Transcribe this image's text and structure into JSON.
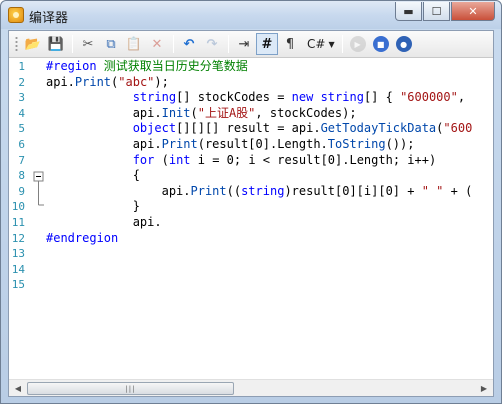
{
  "window": {
    "title": "编译器"
  },
  "toolbar": {
    "buttons": [
      {
        "name": "open-icon",
        "glyph": "📂"
      },
      {
        "name": "save-icon",
        "glyph": "💾"
      },
      {
        "name": "cut-icon",
        "glyph": "✂"
      },
      {
        "name": "copy-icon",
        "glyph": "⧉"
      },
      {
        "name": "paste-icon",
        "glyph": "📋"
      },
      {
        "name": "delete-icon",
        "glyph": "✕"
      },
      {
        "name": "undo-icon",
        "glyph": "↶"
      },
      {
        "name": "redo-icon",
        "glyph": "↷"
      },
      {
        "name": "wordwrap-icon",
        "glyph": "⇥"
      },
      {
        "name": "line-numbers-icon",
        "glyph": "#"
      },
      {
        "name": "paragraph-icon",
        "glyph": "¶"
      }
    ],
    "language": "C#",
    "run_buttons": [
      "run-icon",
      "stop-icon",
      "compile-icon"
    ]
  },
  "editor": {
    "line_numbers": [
      "1",
      "2",
      "3",
      "4",
      "5",
      "6",
      "7",
      "8",
      "9",
      "10",
      "11",
      "12",
      "13",
      "14",
      "15"
    ],
    "lines": [
      [
        {
          "t": "#region",
          "c": "rgkw"
        },
        {
          "t": " 测试获取当日历史分笔数据",
          "c": "rg"
        }
      ],
      [
        {
          "t": "api.",
          "c": "id"
        },
        {
          "t": "Print",
          "c": "mem"
        },
        {
          "t": "(",
          "c": "id"
        },
        {
          "t": "\"abc\"",
          "c": "str"
        },
        {
          "t": ");",
          "c": "id"
        }
      ],
      [
        {
          "t": "            ",
          "c": "id"
        },
        {
          "t": "string",
          "c": "kw"
        },
        {
          "t": "[] stockCodes = ",
          "c": "id"
        },
        {
          "t": "new",
          "c": "kw"
        },
        {
          "t": " ",
          "c": "id"
        },
        {
          "t": "string",
          "c": "kw"
        },
        {
          "t": "[] { ",
          "c": "id"
        },
        {
          "t": "\"600000\"",
          "c": "str"
        },
        {
          "t": ",",
          "c": "id"
        }
      ],
      [
        {
          "t": "            api.",
          "c": "id"
        },
        {
          "t": "Init",
          "c": "mem"
        },
        {
          "t": "(",
          "c": "id"
        },
        {
          "t": "\"上证A股\"",
          "c": "str"
        },
        {
          "t": ", stockCodes);",
          "c": "id"
        }
      ],
      [
        {
          "t": "            ",
          "c": "id"
        },
        {
          "t": "object",
          "c": "kw"
        },
        {
          "t": "[][][] result = api.",
          "c": "id"
        },
        {
          "t": "GetTodayTickData",
          "c": "mem"
        },
        {
          "t": "(",
          "c": "id"
        },
        {
          "t": "\"600",
          "c": "str"
        }
      ],
      [
        {
          "t": "            api.",
          "c": "id"
        },
        {
          "t": "Print",
          "c": "mem"
        },
        {
          "t": "(result[0].Length.",
          "c": "id"
        },
        {
          "t": "ToString",
          "c": "mem"
        },
        {
          "t": "());",
          "c": "id"
        }
      ],
      [
        {
          "t": "            ",
          "c": "id"
        },
        {
          "t": "for",
          "c": "kw"
        },
        {
          "t": " (",
          "c": "id"
        },
        {
          "t": "int",
          "c": "kw"
        },
        {
          "t": " i = 0; i < result[0].Length; i++)",
          "c": "id"
        }
      ],
      [
        {
          "t": "            {",
          "c": "id"
        }
      ],
      [
        {
          "t": "                api.",
          "c": "id"
        },
        {
          "t": "Print",
          "c": "mem"
        },
        {
          "t": "((",
          "c": "id"
        },
        {
          "t": "string",
          "c": "kw"
        },
        {
          "t": ")result[0][i][0] + ",
          "c": "id"
        },
        {
          "t": "\" \"",
          "c": "str"
        },
        {
          "t": " + (",
          "c": "id"
        }
      ],
      [
        {
          "t": "            }",
          "c": "id"
        }
      ],
      [
        {
          "t": "            api.",
          "c": "id"
        }
      ],
      [
        {
          "t": "#endregion",
          "c": "rgkw"
        }
      ],
      [],
      [],
      []
    ]
  },
  "scrollbar": {
    "thumb_grip": "|||"
  }
}
